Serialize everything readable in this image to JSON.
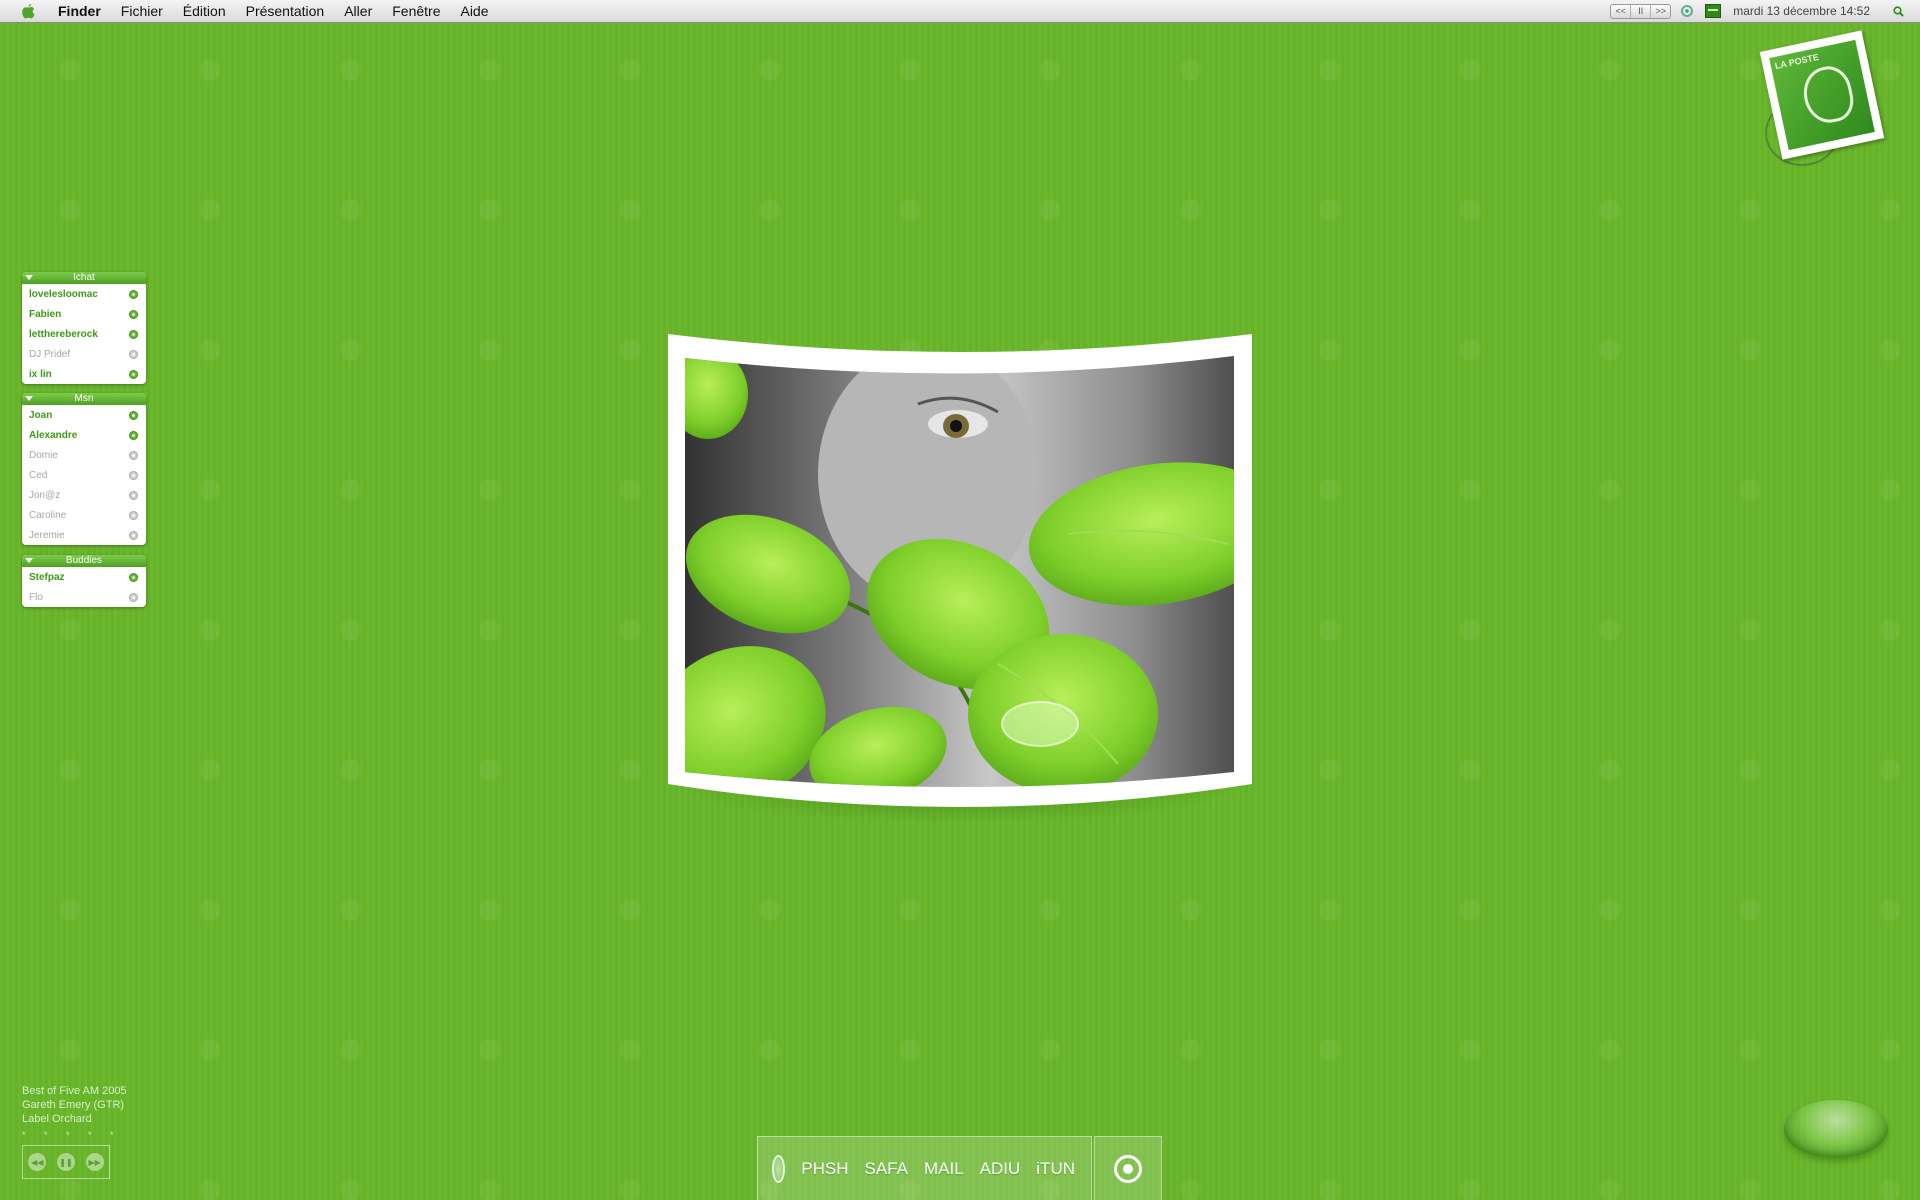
{
  "menubar": {
    "items": [
      "Finder",
      "Fichier",
      "Édition",
      "Présentation",
      "Aller",
      "Fenêtre",
      "Aide"
    ],
    "media_controls": [
      "<<",
      "II",
      ">>"
    ],
    "clock": "mardi 13 décembre 14:52",
    "icons": {
      "apple": "apple-icon",
      "spotlight": "search-icon",
      "status": "status-ring-icon",
      "panel": "panel-icon"
    }
  },
  "widgets": {
    "ichat": {
      "title": "Ichat",
      "buddies": [
        {
          "name": "lovelesloomac",
          "online": true
        },
        {
          "name": "Fabien",
          "online": true
        },
        {
          "name": "letthereberock",
          "online": true
        },
        {
          "name": "DJ Pridef",
          "online": false
        },
        {
          "name": "ix lin",
          "online": true
        }
      ]
    },
    "msn": {
      "title": "Msn",
      "buddies": [
        {
          "name": "Joan",
          "online": true
        },
        {
          "name": "Alexandre",
          "online": true
        },
        {
          "name": "Domie",
          "online": false
        },
        {
          "name": "Ced",
          "online": false
        },
        {
          "name": "Jon@z",
          "online": false
        },
        {
          "name": "Caroline",
          "online": false
        },
        {
          "name": "Jeremie",
          "online": false
        }
      ]
    },
    "buddies": {
      "title": "Buddies",
      "buddies": [
        {
          "name": "Stefpaz",
          "online": true
        },
        {
          "name": "Flo",
          "online": false
        }
      ]
    }
  },
  "now_playing": {
    "line1": "Best of Five AM 2005",
    "line2": "Gareth Emery (GTR)",
    "line3": "Label Orchard",
    "rating": "* * * * *"
  },
  "dock": {
    "items": [
      "PHSH",
      "SAFA",
      "MAIL",
      "ADIU",
      "iTUN"
    ]
  },
  "stamp": {
    "text": "LA POSTE"
  },
  "colors": {
    "accent": "#62bb34",
    "background": "#6bb82e",
    "offline": "#a6a6a6"
  }
}
